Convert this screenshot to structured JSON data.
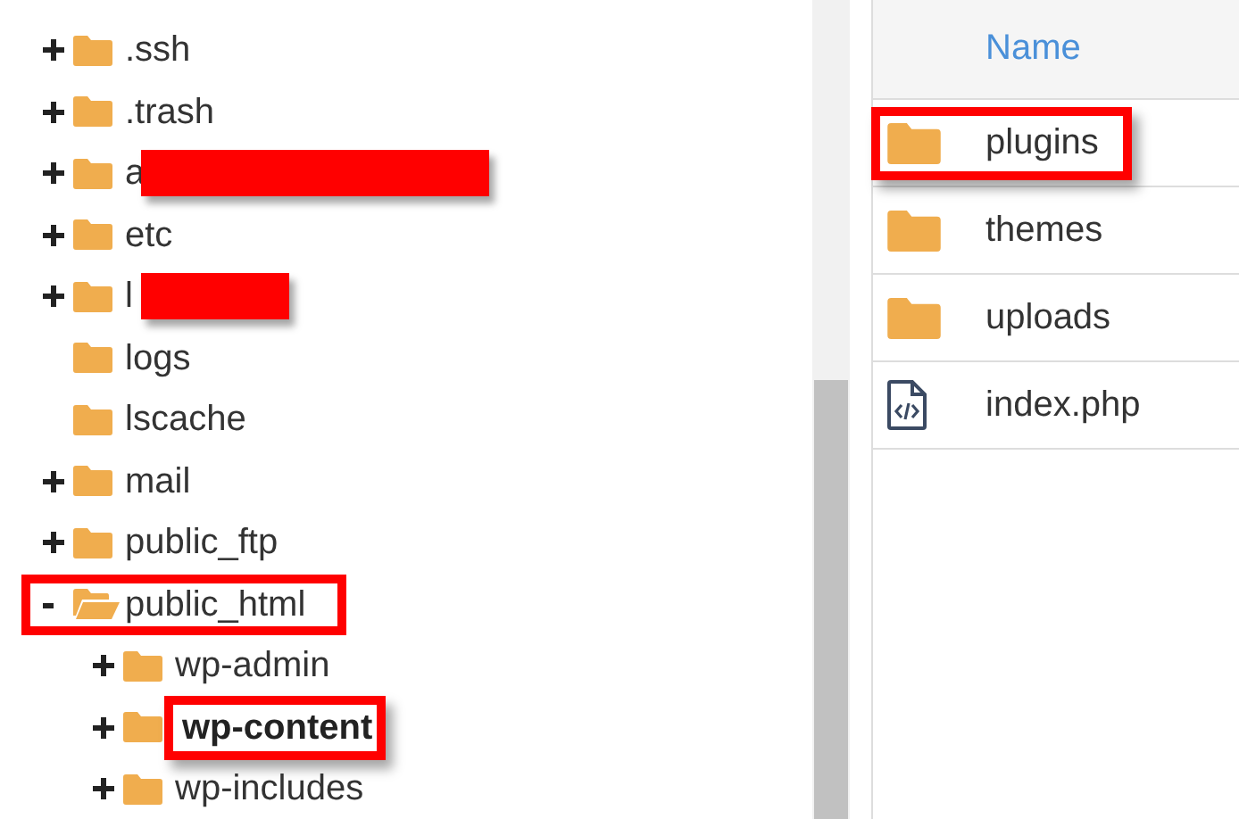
{
  "tree": [
    {
      "label": ".ssh",
      "has_children": true,
      "expanded": false,
      "redacted": false,
      "highlighted": false
    },
    {
      "label": ".trash",
      "has_children": true,
      "expanded": false,
      "redacted": false,
      "highlighted": false
    },
    {
      "label": "a",
      "has_children": true,
      "expanded": false,
      "redacted": true,
      "highlighted": false
    },
    {
      "label": "etc",
      "has_children": true,
      "expanded": false,
      "redacted": false,
      "highlighted": false
    },
    {
      "label": "l",
      "has_children": true,
      "expanded": false,
      "redacted": true,
      "highlighted": false
    },
    {
      "label": "logs",
      "has_children": false,
      "expanded": false,
      "redacted": false,
      "highlighted": false
    },
    {
      "label": "lscache",
      "has_children": false,
      "expanded": false,
      "redacted": false,
      "highlighted": false
    },
    {
      "label": "mail",
      "has_children": true,
      "expanded": false,
      "redacted": false,
      "highlighted": false
    },
    {
      "label": "public_ftp",
      "has_children": true,
      "expanded": false,
      "redacted": false,
      "highlighted": false
    },
    {
      "label": "public_html",
      "has_children": true,
      "expanded": true,
      "redacted": false,
      "highlighted": true,
      "children": [
        {
          "label": "wp-admin",
          "has_children": true,
          "expanded": false,
          "redacted": false,
          "highlighted": false,
          "selected": false
        },
        {
          "label": "wp-content",
          "has_children": true,
          "expanded": false,
          "redacted": false,
          "highlighted": true,
          "selected": true
        },
        {
          "label": "wp-includes",
          "has_children": true,
          "expanded": false,
          "redacted": false,
          "highlighted": false,
          "selected": false
        }
      ]
    }
  ],
  "file_list": {
    "columns": [
      "Name"
    ],
    "rows": [
      {
        "name": "plugins",
        "kind": "folder",
        "highlighted": true
      },
      {
        "name": "themes",
        "kind": "folder",
        "highlighted": false
      },
      {
        "name": "uploads",
        "kind": "folder",
        "highlighted": false
      },
      {
        "name": "index.php",
        "kind": "code-file",
        "highlighted": false
      }
    ]
  }
}
